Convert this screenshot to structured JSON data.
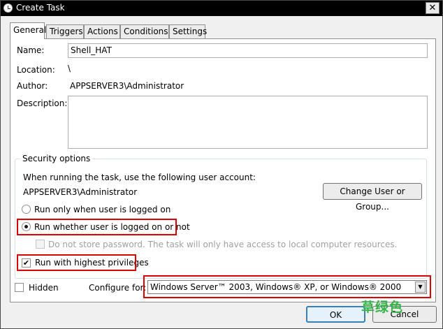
{
  "window": {
    "title": "Create Task",
    "close_glyph": "✕"
  },
  "tabs": [
    {
      "label": "General",
      "active": true
    },
    {
      "label": "Triggers",
      "active": false
    },
    {
      "label": "Actions",
      "active": false
    },
    {
      "label": "Conditions",
      "active": false
    },
    {
      "label": "Settings",
      "active": false
    }
  ],
  "general": {
    "name_label": "Name:",
    "name_value": "Shell_HAT",
    "location_label": "Location:",
    "location_value": "\\",
    "author_label": "Author:",
    "author_value": "APPSERVER3\\Administrator",
    "description_label": "Description:",
    "description_value": ""
  },
  "security": {
    "group_title": "Security options",
    "account_prompt": "When running the task, use the following user account:",
    "account_value": "APPSERVER3\\Administrator",
    "change_button": "Change User or Group...",
    "run_logged_on_label": "Run only when user is logged on",
    "run_logged_on_checked": false,
    "run_whether_label": "Run whether user is logged on or not",
    "run_whether_checked": true,
    "no_store_password_label": "Do not store password.  The task will only have access to local computer resources.",
    "no_store_password_checked": false,
    "highest_priv_label": "Run with highest privileges",
    "highest_priv_checked": true
  },
  "bottom": {
    "hidden_label": "Hidden",
    "hidden_checked": false,
    "configure_label": "Configure for:",
    "configure_value": "Windows Server™ 2003, Windows® XP, or Windows® 2000",
    "check_glyph": "✔",
    "dropdown_glyph": "▼"
  },
  "buttons": {
    "ok": "OK",
    "cancel": "Cancel"
  },
  "watermark": "草绿色",
  "colors": {
    "highlight": "#e00000",
    "watermark": "#36b44a"
  }
}
